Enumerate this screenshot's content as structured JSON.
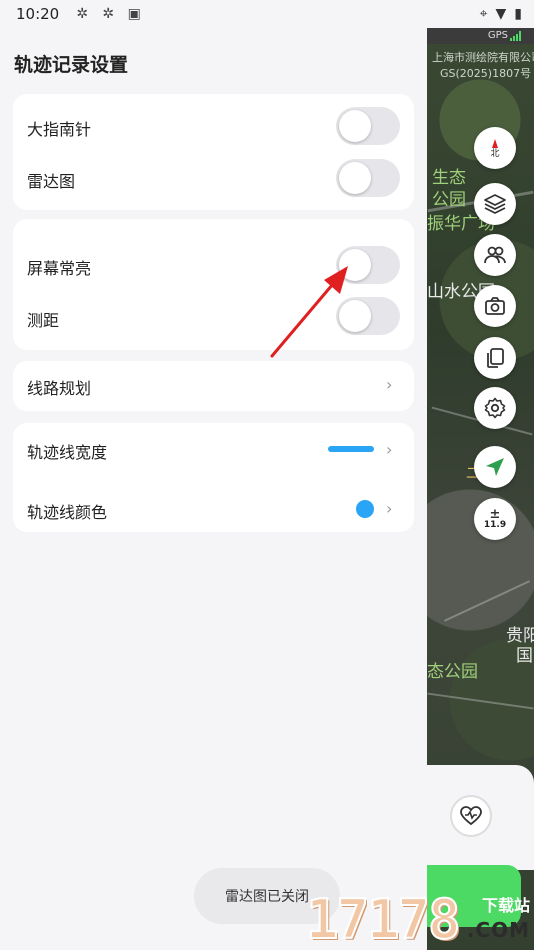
{
  "status_bar": {
    "time": "10:20",
    "left_icons": [
      "sync-icon",
      "sync-icon",
      "app-icon"
    ],
    "right_icons": [
      "location-icon",
      "wifi-icon",
      "battery-icon"
    ],
    "gps_label": "GPS"
  },
  "map": {
    "labels": [
      "上海市测绘院有限公司",
      "GS(2025)1807号",
      "生态",
      "公园",
      "振华广场",
      "山水公园",
      "二环",
      "贵阳",
      "国",
      "态公园"
    ]
  },
  "panel": {
    "title": "轨迹记录设置",
    "groups": [
      {
        "items": [
          {
            "label": "大指南针",
            "control": "toggle",
            "on": false
          },
          {
            "label": "雷达图",
            "control": "toggle",
            "on": false
          }
        ]
      },
      {
        "items": [
          {
            "label": "屏幕常亮",
            "control": "toggle",
            "on": false
          },
          {
            "label": "测距",
            "control": "toggle",
            "on": false
          }
        ]
      },
      {
        "items": [
          {
            "label": "线路规划",
            "control": "chevron"
          }
        ]
      },
      {
        "items": [
          {
            "label": "轨迹线宽度",
            "control": "width-preview"
          },
          {
            "label": "轨迹线颜色",
            "control": "color-preview"
          }
        ]
      }
    ]
  },
  "map_controls": {
    "compass_label": "北",
    "zoom_label": "11.9",
    "zoom_symbol": "±"
  },
  "colors": {
    "accent": "#2aa5f6",
    "toggle_off": "#e6e6ea",
    "panel_bg": "#f5f5f7",
    "annotation_arrow": "#e02020",
    "go_button": "#4cd964"
  },
  "toast": {
    "message": "雷达图已关闭"
  },
  "watermark": {
    "number": "17178",
    "site_label": "下载站",
    "domain": ".COM"
  }
}
